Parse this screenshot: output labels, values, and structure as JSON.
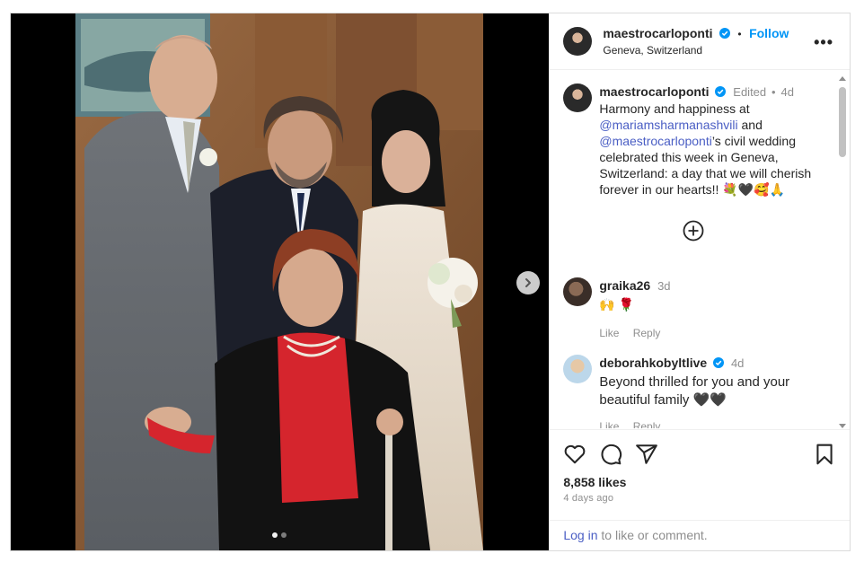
{
  "post": {
    "author": "maestrocarloponti",
    "follow_label": "Follow",
    "separator": "•",
    "location": "Geneva, Switzerland",
    "more_label": "•••"
  },
  "caption": {
    "username": "maestrocarloponti",
    "edited": "Edited",
    "time": "4d",
    "text_1": "Harmony and happiness at",
    "mention_1": "@mariamsharmanashvili",
    "text_2": " and",
    "mention_2": "@maestrocarloponti",
    "text_3": "’s civil wedding celebrated this week in Geneva, Switzerland: a day that we will cherish forever in our hearts!! 💐🖤🥰🙏"
  },
  "comments": [
    {
      "username": "graika26",
      "time": "3d",
      "text": "🙌 🌹",
      "like_label": "Like",
      "reply_label": "Reply"
    },
    {
      "username": "deborahkobyltlive",
      "time": "4d",
      "text": "Beyond thrilled for you and your beautiful family 🖤🖤",
      "like_label": "Like",
      "reply_label": "Reply"
    }
  ],
  "stats": {
    "likes": "8,858 likes",
    "ago": "4 days ago"
  },
  "login": {
    "link": "Log in",
    "rest": " to like or comment."
  },
  "colors": {
    "accent": "#0095f6",
    "link": "#4a5ec4",
    "verified": "#0095f6"
  },
  "icons": [
    "heart-icon",
    "comment-icon",
    "share-icon",
    "bookmark-icon",
    "more-icon",
    "next-arrow-icon",
    "add-comment-icon",
    "verified-icon"
  ]
}
